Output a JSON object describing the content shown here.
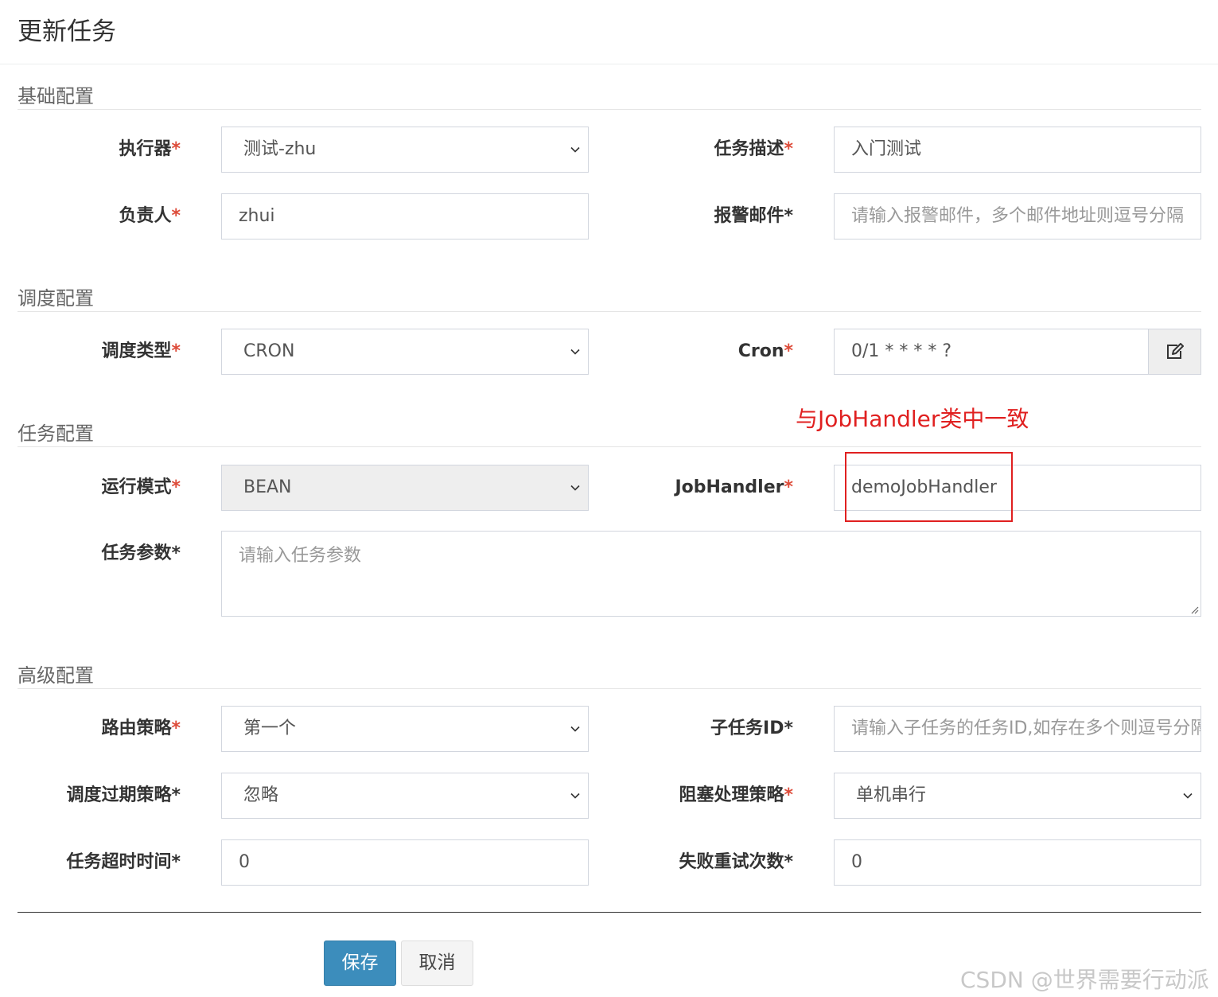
{
  "dialog": {
    "title": "更新任务"
  },
  "sections": {
    "basic": "基础配置",
    "schedule": "调度配置",
    "task": "任务配置",
    "advanced": "高级配置"
  },
  "fields": {
    "executor": {
      "label": "执行器",
      "value": "测试-zhu"
    },
    "job_desc": {
      "label": "任务描述",
      "value": "入门测试"
    },
    "author": {
      "label": "负责人",
      "value": "zhui"
    },
    "alarm_email": {
      "label": "报警邮件",
      "placeholder": "请输入报警邮件，多个邮件地址则逗号分隔"
    },
    "schedule_type": {
      "label": "调度类型",
      "value": "CRON"
    },
    "cron": {
      "label": "Cron",
      "value": "0/1 * * * * ?"
    },
    "glue_type": {
      "label": "运行模式",
      "value": "BEAN"
    },
    "job_handler": {
      "label": "JobHandler",
      "value": "demoJobHandler"
    },
    "job_param": {
      "label": "任务参数",
      "placeholder": "请输入任务参数"
    },
    "route_strategy": {
      "label": "路由策略",
      "value": "第一个"
    },
    "child_job_id": {
      "label": "子任务ID",
      "placeholder": "请输入子任务的任务ID,如存在多个则逗号分隔"
    },
    "misfire_strategy": {
      "label": "调度过期策略",
      "value": "忽略"
    },
    "block_strategy": {
      "label": "阻塞处理策略",
      "value": "单机串行"
    },
    "timeout": {
      "label": "任务超时时间",
      "value": "0"
    },
    "fail_retry": {
      "label": "失败重试次数",
      "value": "0"
    }
  },
  "required_mark": "*",
  "annotation": {
    "text": "与JobHandler类中一致",
    "color": "#e02020"
  },
  "buttons": {
    "save": "保存",
    "cancel": "取消"
  },
  "watermark": "CSDN @世界需要行动派",
  "colors": {
    "primary": "#3c8dbc",
    "required": "#dd4b39"
  }
}
